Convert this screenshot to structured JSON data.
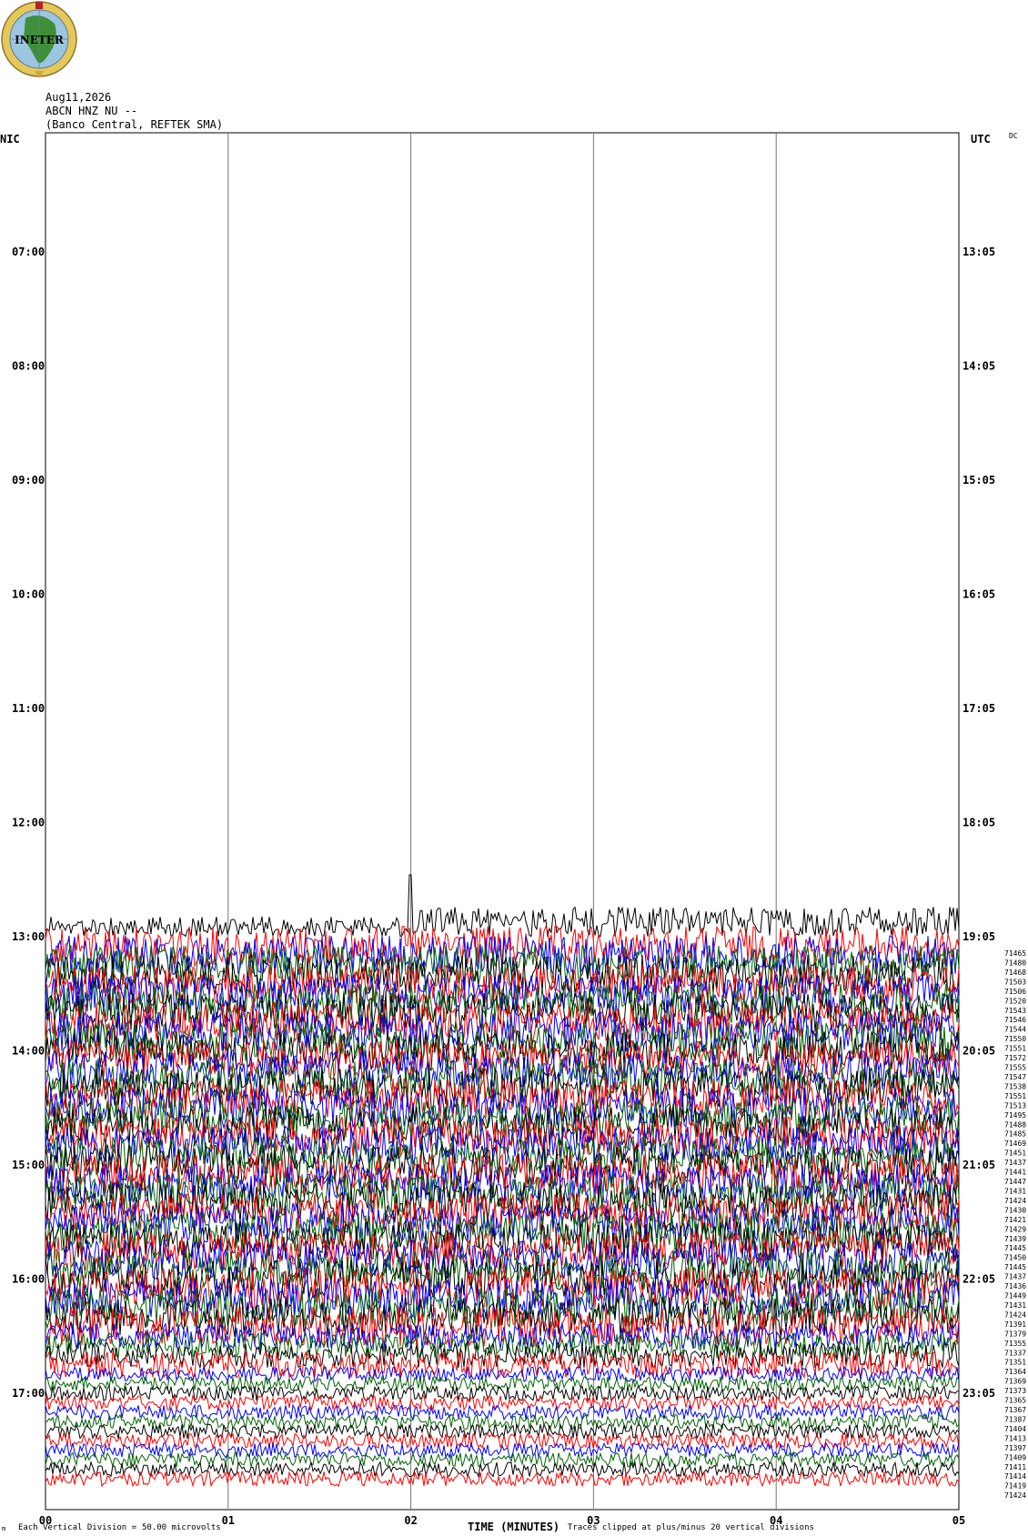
{
  "logo": {
    "text": "INETER",
    "ring_color": "#e6c75a",
    "globe_color": "#9cc6e0",
    "land_color": "#3f8f3a"
  },
  "header": {
    "date": "Aug11,2026",
    "station": "ABCN HNZ NU --",
    "location": "(Banco Central, REFTEK SMA)"
  },
  "labels": {
    "left_tz": "NIC",
    "right_tz": "UTC",
    "right_tag": "DC",
    "x_title": "TIME (MINUTES)",
    "scale_note": "Each Vertical Division =",
    "scale_value": "50.00 microvolts",
    "clip_note": "Traces clipped at plus/minus 20 vertical divisions",
    "corner_mark": "m"
  },
  "chart_data": {
    "type": "line",
    "x_ticks": [
      "00",
      "01",
      "02",
      "03",
      "04",
      "05"
    ],
    "xlim": [
      0,
      5
    ],
    "left_hour_labels": [
      "07:00",
      "08:00",
      "09:00",
      "10:00",
      "11:00",
      "12:00",
      "13:00",
      "14:00",
      "15:00",
      "16:00",
      "17:00"
    ],
    "right_hour_labels": [
      "13:05",
      "14:05",
      "15:05",
      "16:05",
      "17:05",
      "18:05",
      "19:05",
      "20:05",
      "21:05",
      "22:05",
      "23:05"
    ],
    "trace_colors": [
      "#000000",
      "#ff0000",
      "#0000ff",
      "#006400"
    ],
    "trace_start_hour": "13:00",
    "trace_end_hour": "17:55",
    "trace_counts": [
      71465,
      71480,
      71468,
      71503,
      71506,
      71520,
      71543,
      71546,
      71544,
      71550,
      71551,
      71572,
      71555,
      71547,
      71538,
      71551,
      71513,
      71495,
      71488,
      71485,
      71469,
      71451,
      71437,
      71441,
      71447,
      71431,
      71424,
      71430,
      71421,
      71429,
      71439,
      71445,
      71450,
      71445,
      71437,
      71436,
      71449,
      71431,
      71424,
      71391,
      71379,
      71355,
      71337,
      71351,
      71364,
      71369,
      71373,
      71365,
      71367,
      71387,
      71404,
      71413,
      71397,
      71409,
      71411,
      71414,
      71419,
      71424
    ],
    "grid": true
  }
}
